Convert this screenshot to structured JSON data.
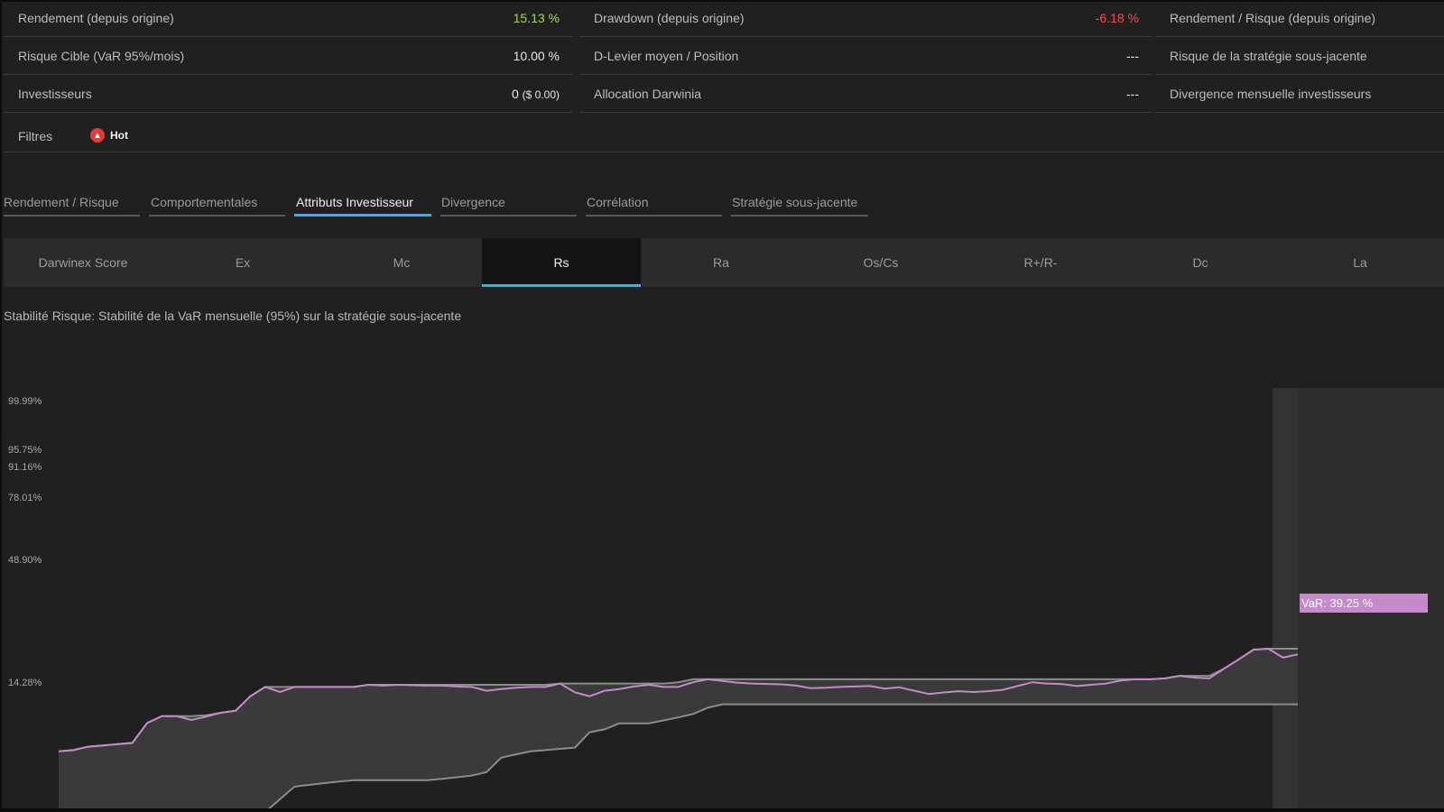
{
  "stats": {
    "rows": [
      [
        {
          "label": "Rendement (depuis origine)",
          "value": "15.13 %",
          "tone": "green"
        },
        {
          "label": "Drawdown (depuis origine)",
          "value": "-6.18 %",
          "tone": "red"
        },
        {
          "label": "Rendement / Risque (depuis origine)",
          "value": ""
        }
      ],
      [
        {
          "label": "Risque Cible (VaR 95%/mois)",
          "value": "10.00 %"
        },
        {
          "label": "D-Levier moyen / Position",
          "value": "---"
        },
        {
          "label": "Risque de la stratégie sous-jacente",
          "value": ""
        }
      ],
      [
        {
          "label": "Investisseurs",
          "value": "0",
          "value_suffix": "($ 0.00)"
        },
        {
          "label": "Allocation Darwinia",
          "value": "---"
        },
        {
          "label": "Divergence mensuelle investisseurs",
          "value": ""
        }
      ]
    ]
  },
  "filters": {
    "label": "Filtres",
    "badge": "Hot",
    "badge_icon": "flame-icon"
  },
  "tabs": [
    {
      "label": "Rendement / Risque",
      "active": false
    },
    {
      "label": "Comportementales",
      "active": false
    },
    {
      "label": "Attributs Investisseur",
      "active": true
    },
    {
      "label": "Divergence",
      "active": false
    },
    {
      "label": "Corrélation",
      "active": false
    },
    {
      "label": "Stratégie sous-jacente",
      "active": false
    }
  ],
  "subtabs": [
    {
      "label": "Darwinex Score",
      "active": false
    },
    {
      "label": "Ex",
      "active": false
    },
    {
      "label": "Mc",
      "active": false
    },
    {
      "label": "Rs",
      "active": true
    },
    {
      "label": "Ra",
      "active": false
    },
    {
      "label": "Os/Cs",
      "active": false
    },
    {
      "label": "R+/R-",
      "active": false
    },
    {
      "label": "Dc",
      "active": false
    },
    {
      "label": "La",
      "active": false
    }
  ],
  "description": "Stabilité Risque: Stabilité de la VaR mensuelle (95%) sur la stratégie sous-jacente",
  "colors": {
    "accent": "#29b6e8",
    "positive": "#a6d94a",
    "negative": "#ff4a4a",
    "var_line": "#c689cc",
    "band_fill": "#3a3a3a"
  },
  "chart_data": {
    "type": "area",
    "y_tick_labels": [
      "99.99%",
      "95.75%",
      "91.16%",
      "78.01%",
      "48.90%",
      "14.28%"
    ],
    "var_label": "VaR: 39.25 %",
    "series": [
      {
        "role": "var",
        "values": [
          14.3,
          14.6,
          15.4,
          15.7,
          16.0,
          16.3,
          21.0,
          22.6,
          22.6,
          21.7,
          22.5,
          23.4,
          23.9,
          27.3,
          29.5,
          28.3,
          29.5,
          29.5,
          29.5,
          29.5,
          29.5,
          30.0,
          29.8,
          30.0,
          29.9,
          29.8,
          29.8,
          29.6,
          29.5,
          28.6,
          29.0,
          29.3,
          29.5,
          29.5,
          30.3,
          28.2,
          27.3,
          28.6,
          29.0,
          29.6,
          30.0,
          29.5,
          29.5,
          30.6,
          31.3,
          30.9,
          30.5,
          30.3,
          30.2,
          30.1,
          29.8,
          29.2,
          29.3,
          29.5,
          29.6,
          29.7,
          29.1,
          29.4,
          28.6,
          27.8,
          28.2,
          28.5,
          28.3,
          28.5,
          28.8,
          29.7,
          30.6,
          30.3,
          30.2,
          29.7,
          30.0,
          30.3,
          31.0,
          31.3,
          31.3,
          31.5,
          32.1,
          31.7,
          31.5,
          33.8,
          36.0,
          38.3,
          38.5,
          36.4,
          37.2
        ]
      },
      {
        "role": "upper_envelope",
        "values": [
          14.3,
          14.6,
          15.4,
          15.7,
          16.0,
          16.3,
          21.0,
          22.6,
          22.6,
          22.6,
          22.8,
          23.4,
          23.9,
          27.3,
          29.5,
          29.5,
          29.5,
          29.5,
          29.5,
          29.5,
          29.5,
          30.0,
          30.0,
          30.0,
          30.0,
          30.0,
          30.0,
          30.0,
          30.0,
          30.0,
          30.0,
          30.0,
          30.0,
          30.0,
          30.3,
          30.3,
          30.3,
          30.3,
          30.3,
          30.3,
          30.3,
          30.3,
          30.6,
          31.3,
          31.3,
          31.3,
          31.3,
          31.3,
          31.3,
          31.3,
          31.3,
          31.3,
          31.3,
          31.3,
          31.3,
          31.3,
          31.3,
          31.3,
          31.3,
          31.3,
          31.3,
          31.3,
          31.3,
          31.3,
          31.3,
          31.3,
          31.3,
          31.3,
          31.3,
          31.3,
          31.3,
          31.3,
          31.3,
          31.3,
          31.3,
          31.5,
          32.1,
          32.1,
          32.1,
          33.8,
          36.0,
          38.3,
          38.5,
          38.5,
          38.5
        ]
      },
      {
        "role": "lower_envelope",
        "values": [
          null,
          null,
          null,
          null,
          null,
          null,
          null,
          null,
          null,
          null,
          null,
          null,
          null,
          null,
          0.0,
          3.0,
          6.0,
          6.4,
          6.8,
          7.2,
          7.5,
          7.5,
          7.5,
          7.5,
          7.5,
          7.5,
          7.8,
          8.2,
          8.6,
          9.4,
          12.8,
          13.6,
          14.3,
          14.6,
          14.9,
          15.2,
          18.8,
          19.5,
          20.9,
          20.9,
          20.9,
          21.6,
          22.3,
          23.1,
          24.6,
          25.4,
          25.4,
          25.4,
          25.4,
          25.4,
          25.4,
          25.4,
          25.4,
          25.4,
          25.4,
          25.4,
          25.4,
          25.4,
          25.4,
          25.4,
          25.4,
          25.4,
          25.4,
          25.4,
          25.4,
          25.4,
          25.4,
          25.4,
          25.4,
          25.4,
          25.4,
          25.4,
          25.4,
          25.4,
          25.4,
          25.4,
          25.4,
          25.4,
          25.4,
          25.4,
          25.4,
          25.4,
          25.4,
          25.4,
          25.4
        ]
      }
    ]
  }
}
